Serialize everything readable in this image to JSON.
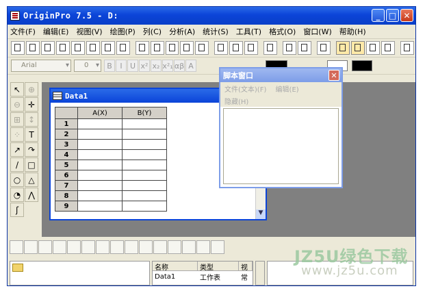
{
  "window": {
    "title": "OriginPro 7.5 - D:",
    "minimize": "_",
    "maximize": "□",
    "close": "✕"
  },
  "menubar": [
    "文件(F)",
    "编辑(E)",
    "视图(V)",
    "绘图(P)",
    "列(C)",
    "分析(A)",
    "统计(S)",
    "工具(T)",
    "格式(O)",
    "窗口(W)",
    "帮助(H)"
  ],
  "format_bar": {
    "font": "Arial",
    "size": "0",
    "bold": "B",
    "italic": "I",
    "underline": "U",
    "superscript": "x²",
    "subscript": "x₂",
    "supsub": "x²₁",
    "greek": "αβ",
    "grow": "A",
    "colors": [
      "#000000",
      "#ffffff",
      "#000000"
    ]
  },
  "worksheet": {
    "title": "Data1",
    "columns": [
      "A(X)",
      "B(Y)"
    ],
    "rows": [
      "1",
      "2",
      "3",
      "4",
      "5",
      "6",
      "7",
      "8",
      "9"
    ]
  },
  "script_window": {
    "title": "脚本窗口",
    "menu": [
      "文件(文本)(F)",
      "编辑(E)"
    ],
    "menu2": "隐藏(H)",
    "close": "✕"
  },
  "project_explorer": {
    "headers": [
      "名称",
      "类型",
      "视"
    ],
    "rows": [
      {
        "name": "Data1",
        "type": "工作表",
        "view": "常"
      }
    ]
  },
  "watermark": {
    "line1": "JZ5U绿色下载",
    "line2": "www.jz5u.com"
  }
}
